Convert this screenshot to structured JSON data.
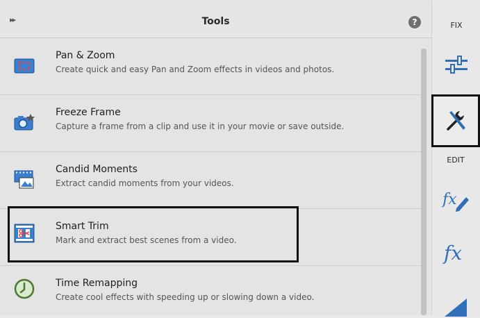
{
  "header": {
    "title": "Tools",
    "collapse_glyph": "▸▸",
    "help_glyph": "?"
  },
  "tools": [
    {
      "name": "Pan & Zoom",
      "description": "Create quick and easy Pan and Zoom effects in videos and photos.",
      "icon": "pan-zoom-icon"
    },
    {
      "name": "Freeze Frame",
      "description": "Capture a frame from a clip and use it in your movie or save outside.",
      "icon": "camera-icon"
    },
    {
      "name": "Candid Moments",
      "description": "Extract candid moments from your videos.",
      "icon": "candid-moments-icon"
    },
    {
      "name": "Smart Trim",
      "description": "Mark and extract best scenes from a video.",
      "icon": "smart-trim-icon"
    },
    {
      "name": "Time Remapping",
      "description": "Create cool effects with speeding up or slowing down a video.",
      "icon": "clock-icon"
    }
  ],
  "rail": {
    "fix_label": "FIX",
    "edit_label": "EDIT",
    "buttons": [
      "adjust-sliders-icon",
      "tools-wrench-icon",
      "fx-edit-icon",
      "fx-icon",
      "titles-icon"
    ]
  },
  "colors": {
    "accent_blue": "#2f6fb8",
    "highlight_border": "#111111"
  }
}
